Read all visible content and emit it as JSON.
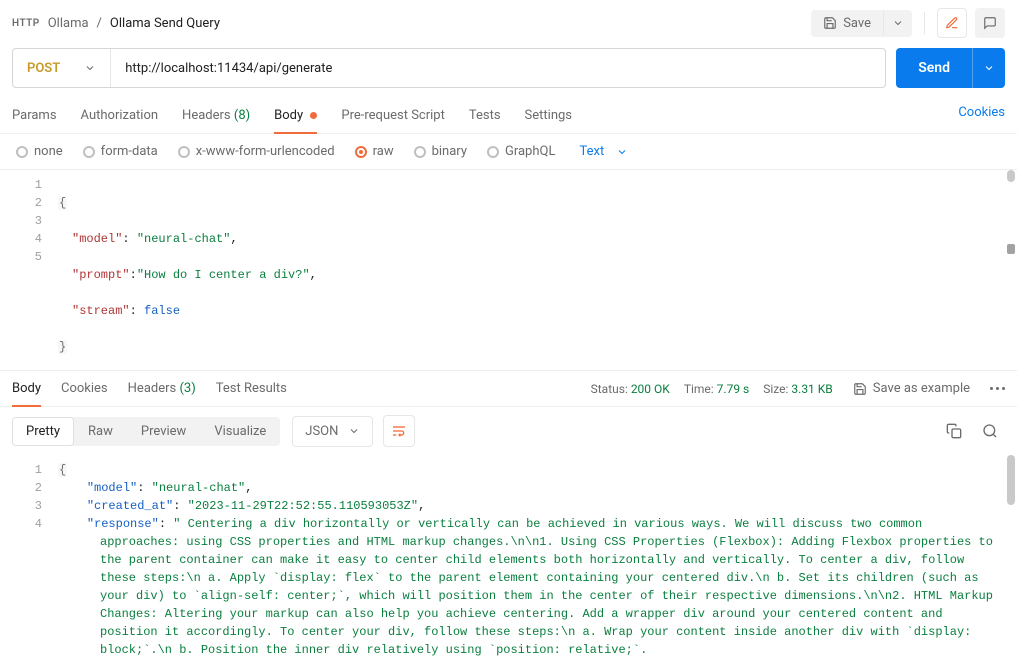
{
  "breadcrumb": {
    "http_badge": "HTTP",
    "folder": "Ollama",
    "request": "Ollama Send Query"
  },
  "toolbar": {
    "save_label": "Save"
  },
  "request": {
    "method": "POST",
    "url": "http://localhost:11434/api/generate",
    "send_label": "Send"
  },
  "tabs": {
    "params": "Params",
    "authorization": "Authorization",
    "headers_label": "Headers",
    "headers_count": "(8)",
    "body": "Body",
    "prerequest": "Pre-request Script",
    "tests": "Tests",
    "settings": "Settings",
    "cookies": "Cookies"
  },
  "body_types": {
    "none": "none",
    "formdata": "form-data",
    "urlencoded": "x-www-form-urlencoded",
    "raw": "raw",
    "binary": "binary",
    "graphql": "GraphQL",
    "format_label": "Text"
  },
  "editor": {
    "lines": [
      "1",
      "2",
      "3",
      "4",
      "5"
    ],
    "l1_open": "{",
    "l2_key": "\"model\"",
    "l2_val": "\"neural-chat\"",
    "l3_key": "\"prompt\"",
    "l3_val": "\"How do I center a div?\"",
    "l4_key": "\"stream\"",
    "l4_val": "false",
    "l5_close": "}"
  },
  "response_tabs": {
    "body": "Body",
    "cookies": "Cookies",
    "headers_label": "Headers",
    "headers_count": "(3)",
    "test_results": "Test Results"
  },
  "response_meta": {
    "status_label": "Status:",
    "status_value": "200 OK",
    "time_label": "Time:",
    "time_value": "7.79 s",
    "size_label": "Size:",
    "size_value": "3.31 KB",
    "save_example": "Save as example"
  },
  "response_toolbar": {
    "pretty": "Pretty",
    "raw": "Raw",
    "preview": "Preview",
    "visualize": "Visualize",
    "format": "JSON"
  },
  "response_body": {
    "lines": [
      "1",
      "2",
      "3",
      "4"
    ],
    "l1_open": "{",
    "l2_key": "\"model\"",
    "l2_val": "\"neural-chat\"",
    "l3_key": "\"created_at\"",
    "l3_val": "\"2023-11-29T22:52:55.110593053Z\"",
    "l4_key": "\"response\"",
    "l4_val": "\" Centering a div horizontally or vertically can be achieved in various ways. We will discuss two common approaches: using CSS properties and HTML markup changes.\\n\\n1. Using CSS Properties (Flexbox): Adding Flexbox properties to the parent container can make it easy to center child elements both horizontally and vertically. To center a div, follow these steps:\\n   a. Apply `display: flex` to the parent element containing your centered div.\\n   b. Set its children (such as your div) to `align-self: center;`, which will position them in the center of their respective dimensions.\\n\\n2. HTML Markup Changes: Altering your markup can also help you achieve centering. Add a wrapper div around your centered content and position it accordingly. To center your div, follow these steps:\\n   a. Wrap your content inside another div with `display: block;`.\\n   b. Position the inner div relatively using `position: relative;`."
  }
}
